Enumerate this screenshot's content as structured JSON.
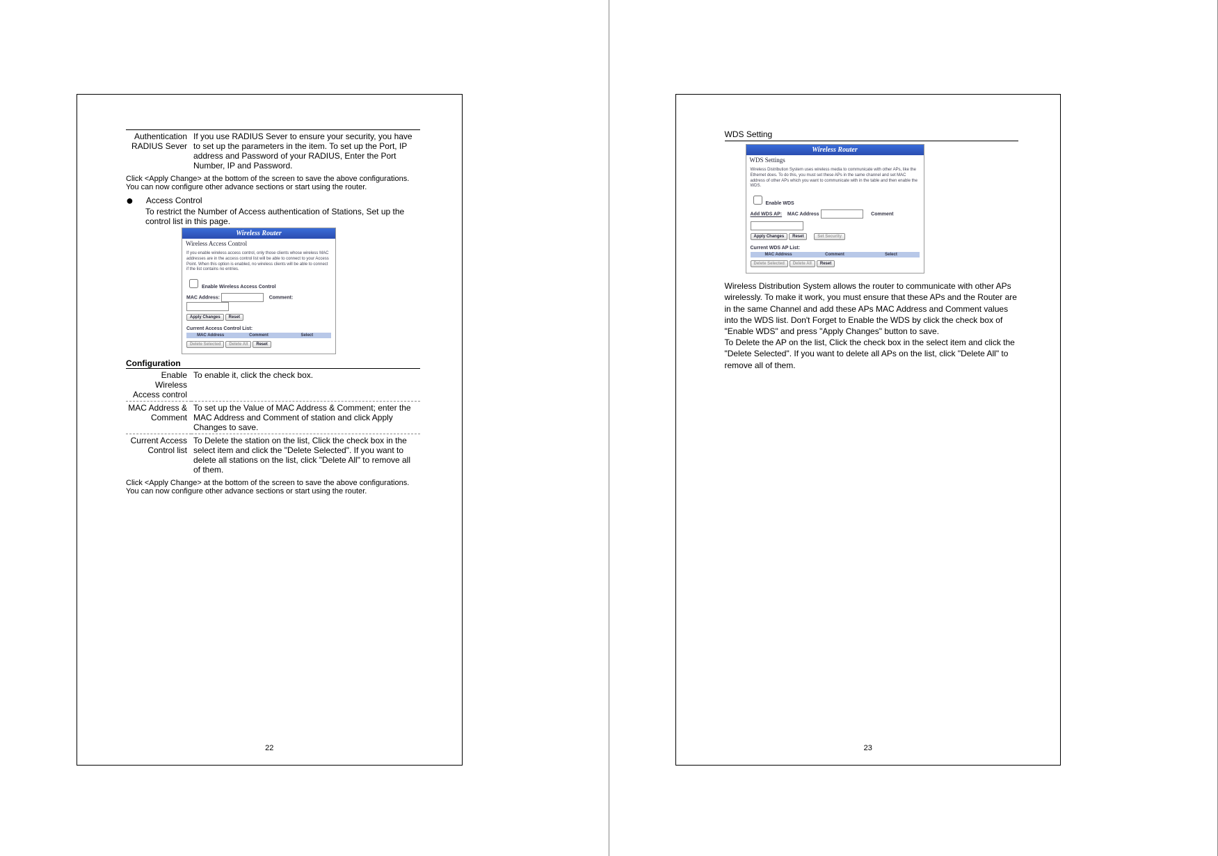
{
  "left": {
    "auth_label": "Authentication RADIUS Sever",
    "auth_desc": "If you use RADIUS Sever to ensure your security, you have to set up the parameters in the item. To set up the Port, IP address and Password of your RADIUS, Enter the Port Number, IP and Password.",
    "note1": "Click <Apply Change> at the bottom of the screen to save the above configurations. You can now configure other advance sections or start using the router.",
    "access_control": "Access Control",
    "access_desc": "To restrict the Number of Access authentication of Stations, Set up the control list in this page.",
    "ss": {
      "brand": "Wireless Router",
      "title": "Wireless Access Control",
      "desc": "If you enable wireless access control, only those clients whose wireless MAC addresses are in the access control list will be able to connect to your Access Point. When this option is enabled, no wireless clients will be able to connect if the list contains no entries.",
      "enable": "Enable Wireless Access Control",
      "mac": "MAC Address:",
      "comment": "Comment:",
      "apply": "Apply Changes",
      "reset": "Reset",
      "list_label": "Current Access Control List:",
      "col1": "MAC Address",
      "col2": "Comment",
      "col3": "Select",
      "del_sel": "Delete Selected",
      "del_all": "Delete All",
      "reset2": "Reset"
    },
    "config": "Configuration",
    "row1_label": "Enable Wireless Access control",
    "row1_val": "To enable it, click the check box.",
    "row2_label": "MAC Address & Comment",
    "row2_val": "To set up the Value of MAC Address & Comment; enter the MAC Address and Comment of station and click Apply Changes to save.",
    "row3_label": "Current Access Control list",
    "row3_val": "To Delete the station on the list, Click the check box in the select item and click the \"Delete Selected\". If you want to delete all stations on the list, click \"Delete All\" to remove all of them.",
    "note2": "Click <Apply Change> at the bottom of the screen to save the above configurations. You can now configure other advance sections or start using the router.",
    "pagenum": "22"
  },
  "right": {
    "wds_setting": "WDS Setting",
    "ss": {
      "brand": "Wireless Router",
      "title": "WDS Settings",
      "desc": "Wireless Distribution System uses wireless media to communicate with other APs, like the Ethernet does. To do this, you must set these APs in the same channel and set MAC address of other APs which you want to communicate with in the table and then enable the WDS.",
      "enable": "Enable WDS",
      "add_label": "Add WDS AP:",
      "mac": "MAC Address",
      "comment": "Comment",
      "apply": "Apply Changes",
      "reset": "Reset",
      "sec": "Set Security",
      "list_label": "Current WDS AP List:",
      "col1": "MAC Address",
      "col2": "Comment",
      "col3": "Select",
      "del_sel": "Delete Selected",
      "del_all": "Delete All",
      "reset2": "Reset"
    },
    "para1": "Wireless Distribution System allows the router to communicate with other APs wirelessly. To make it work, you must ensure that these APs and the Router are in the same Channel and add these APs MAC Address and Comment values into the WDS list. Don't Forget to Enable the WDS by click the check box of \"Enable WDS\" and press \"Apply Changes\" button to save.",
    "para2": "To Delete the AP on the list, Click the check box in the select item and click the \"Delete Selected\". If you want to delete all APs on the list, click \"Delete All\" to remove all of them.",
    "pagenum": "23"
  }
}
